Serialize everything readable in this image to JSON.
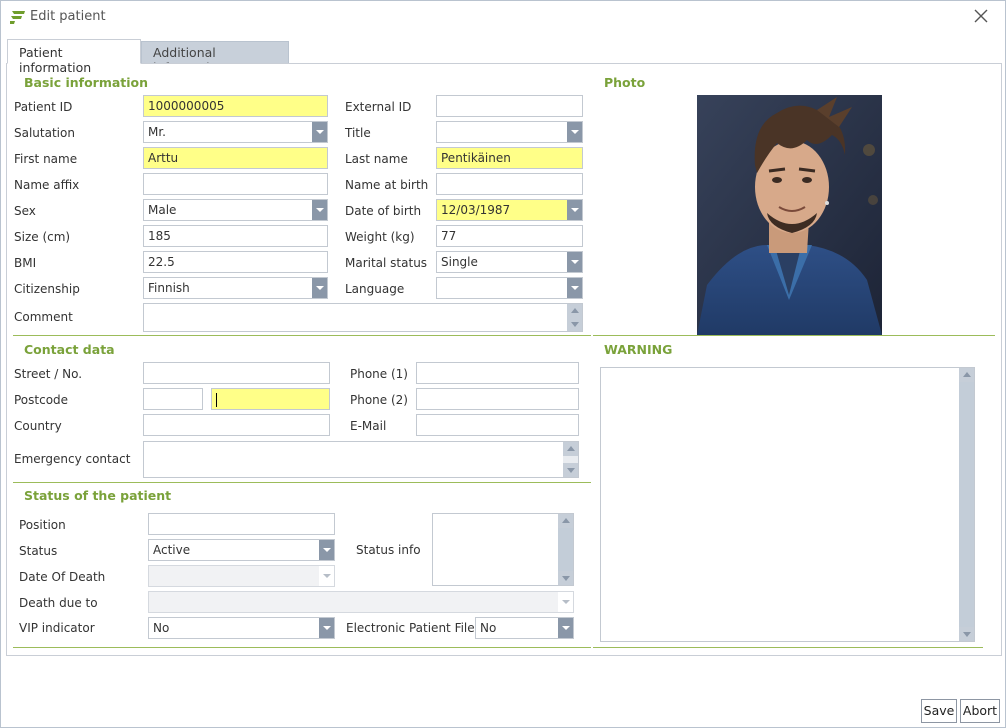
{
  "window": {
    "title": "Edit patient"
  },
  "tabs": [
    "Patient information",
    "Additional information"
  ],
  "sections": {
    "basic": "Basic information",
    "photo": "Photo",
    "contact": "Contact data",
    "warning": "WARNING",
    "status": "Status of the patient"
  },
  "basic": {
    "patient_id": {
      "label": "Patient ID",
      "value": "1000000005"
    },
    "external_id": {
      "label": "External ID",
      "value": ""
    },
    "salutation": {
      "label": "Salutation",
      "value": "Mr."
    },
    "title": {
      "label": "Title",
      "value": ""
    },
    "first_name": {
      "label": "First name",
      "value": "Arttu"
    },
    "last_name": {
      "label": "Last name",
      "value": "Pentikäinen"
    },
    "name_affix": {
      "label": "Name affix",
      "value": ""
    },
    "name_at_birth": {
      "label": "Name at birth",
      "value": ""
    },
    "sex": {
      "label": "Sex",
      "value": "Male"
    },
    "date_of_birth": {
      "label": "Date of birth",
      "value": "12/03/1987"
    },
    "size": {
      "label": "Size (cm)",
      "value": "185"
    },
    "weight": {
      "label": "Weight (kg)",
      "value": "77"
    },
    "bmi": {
      "label": "BMI",
      "value": "22.5"
    },
    "marital_status": {
      "label": "Marital status",
      "value": "Single"
    },
    "citizenship": {
      "label": "Citizenship",
      "value": "Finnish"
    },
    "language": {
      "label": "Language",
      "value": ""
    },
    "comment": {
      "label": "Comment",
      "value": ""
    }
  },
  "contact": {
    "street": {
      "label": "Street / No.",
      "value": ""
    },
    "phone1": {
      "label": "Phone (1)",
      "value": ""
    },
    "postcode": {
      "label": "Postcode",
      "value": ""
    },
    "city": {
      "value": ""
    },
    "phone2": {
      "label": "Phone (2)",
      "value": ""
    },
    "country": {
      "label": "Country",
      "value": ""
    },
    "email": {
      "label": "E-Mail",
      "value": ""
    },
    "emergency": {
      "label": "Emergency contact",
      "value": ""
    }
  },
  "status": {
    "position": {
      "label": "Position",
      "value": ""
    },
    "status": {
      "label": "Status",
      "value": "Active"
    },
    "status_info": {
      "label": "Status info",
      "value": ""
    },
    "date_of_death": {
      "label": "Date Of Death",
      "value": ""
    },
    "death_due_to": {
      "label": "Death due to",
      "value": ""
    },
    "vip": {
      "label": "VIP indicator",
      "value": "No"
    },
    "epf": {
      "label": "Electronic Patient File",
      "value": "No"
    }
  },
  "buttons": {
    "save": "Save",
    "abort": "Abort"
  },
  "colors": {
    "section_title": "#7aa23a",
    "required": "#ffff88",
    "accent_logo": "#6f9d2c",
    "tab_inactive": "#c8d0da"
  },
  "icons": {
    "app": "app-logo-icon",
    "close": "close-icon",
    "dropdown": "chevron-down-icon"
  }
}
